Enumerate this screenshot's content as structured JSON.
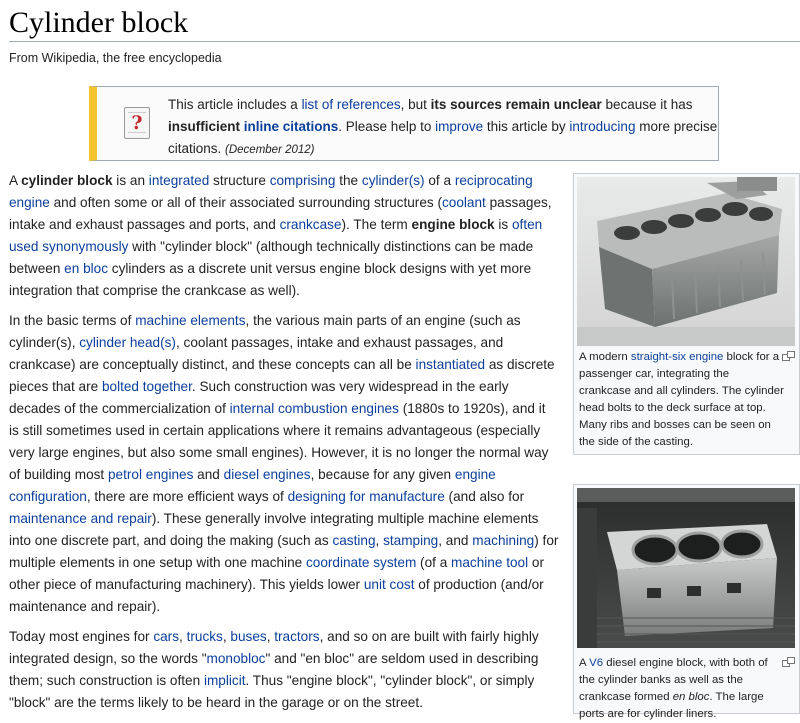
{
  "page": {
    "title": "Cylinder block",
    "tagline": "From Wikipedia, the free encyclopedia"
  },
  "notice": {
    "icon": "question-book-icon",
    "icon_glyph": "?",
    "t1": "This article includes a ",
    "l1": "list of references",
    "t2": ", but ",
    "b1": "its sources remain unclear",
    "t3": " because it has ",
    "b2": "insufficient ",
    "l2": "inline citations",
    "t4": ". Please help to ",
    "l3": "improve",
    "t5": " this article by ",
    "l4": "introducing",
    "t6": " more precise citations. ",
    "date": "(December 2012)"
  },
  "article": {
    "p1": [
      {
        "t": "A "
      },
      {
        "b": "cylinder block"
      },
      {
        "t": " is an "
      },
      {
        "l": "integrated"
      },
      {
        "t": " structure "
      },
      {
        "l": "comprising"
      },
      {
        "t": " the "
      },
      {
        "l": "cylinder(s)"
      },
      {
        "t": " of a "
      },
      {
        "l": "reciprocating engine"
      },
      {
        "t": " and often some or all of their associated surrounding structures ("
      },
      {
        "l": "coolant"
      },
      {
        "t": " passages, intake and exhaust passages and ports, and "
      },
      {
        "l": "crankcase"
      },
      {
        "t": "). The term "
      },
      {
        "b": "engine block"
      },
      {
        "t": " is "
      },
      {
        "l": "often used synonymously"
      },
      {
        "t": " with \"cylinder block\" (although technically distinctions can be made between "
      },
      {
        "l": "en bloc"
      },
      {
        "t": " cylinders as a discrete unit versus engine block designs with yet more integration that comprise the crankcase as well)."
      }
    ],
    "p2": [
      {
        "t": "In the basic terms of "
      },
      {
        "l": "machine elements"
      },
      {
        "t": ", the various main parts of an engine (such as cylinder(s), "
      },
      {
        "l": "cylinder head(s)"
      },
      {
        "t": ", coolant passages, intake and exhaust passages, and crankcase) are conceptually distinct, and these concepts can all be "
      },
      {
        "l": "instantiated"
      },
      {
        "t": " as discrete pieces that are "
      },
      {
        "l": "bolted together"
      },
      {
        "t": ". Such construction was very widespread in the early decades of the commercialization of "
      },
      {
        "l": "internal combustion engines"
      },
      {
        "t": " (1880s to 1920s), and it is still sometimes used in certain applications where it remains advantageous (especially very large engines, but also some small engines). However, it is no longer the normal way of building most "
      },
      {
        "l": "petrol engines"
      },
      {
        "t": " and "
      },
      {
        "l": "diesel engines"
      },
      {
        "t": ", because for any given "
      },
      {
        "l": "engine configuration"
      },
      {
        "t": ", there are more efficient ways of "
      },
      {
        "l": "designing for manufacture"
      },
      {
        "t": " (and also for "
      },
      {
        "l": "maintenance and repair"
      },
      {
        "t": "). These generally involve integrating multiple machine elements into one discrete part, and doing the making (such as "
      },
      {
        "l": "casting"
      },
      {
        "t": ", "
      },
      {
        "l": "stamping"
      },
      {
        "t": ", and "
      },
      {
        "l": "machining"
      },
      {
        "t": ") for multiple elements in one setup with one machine "
      },
      {
        "l": "coordinate system"
      },
      {
        "t": " (of a "
      },
      {
        "l": "machine tool"
      },
      {
        "t": " or other piece of manufacturing machinery). This yields lower "
      },
      {
        "l": "unit cost"
      },
      {
        "t": " of production (and/or maintenance and repair)."
      }
    ],
    "p3": [
      {
        "t": "Today most engines for "
      },
      {
        "l": "cars"
      },
      {
        "t": ", "
      },
      {
        "l": "trucks"
      },
      {
        "t": ", "
      },
      {
        "l": "buses"
      },
      {
        "t": ", "
      },
      {
        "l": "tractors"
      },
      {
        "t": ", and so on are built with fairly highly integrated design, so the words \""
      },
      {
        "l": "monobloc"
      },
      {
        "t": "\" and \"en bloc\" are seldom used in describing them; such construction is often "
      },
      {
        "l": "implicit"
      },
      {
        "t": ". Thus \"engine block\", \"cylinder block\", or simply \"block\" are the terms likely to be heard in the garage or on the street."
      }
    ]
  },
  "figures": [
    {
      "image_icon": "engine-block-photo",
      "caption": [
        {
          "t": "A modern "
        },
        {
          "l": "straight-six engine"
        },
        {
          "t": " block for a passenger car, integrating the crankcase and all cylinders. The cylinder head bolts to the deck surface at top. Many ribs and bosses can be seen on the side of the casting."
        }
      ]
    },
    {
      "image_icon": "v6-engine-block-photo",
      "caption": [
        {
          "t": "A "
        },
        {
          "l": "V6"
        },
        {
          "t": " diesel engine block, with both of the cylinder banks as well as the crankcase formed "
        },
        {
          "i": "en bloc"
        },
        {
          "t": ". The large ports are for cylinder liners."
        }
      ]
    }
  ],
  "colors": {
    "link": "#0b3f9c",
    "notice_stripe": "#f4c430",
    "border": "#a2a9b1"
  }
}
